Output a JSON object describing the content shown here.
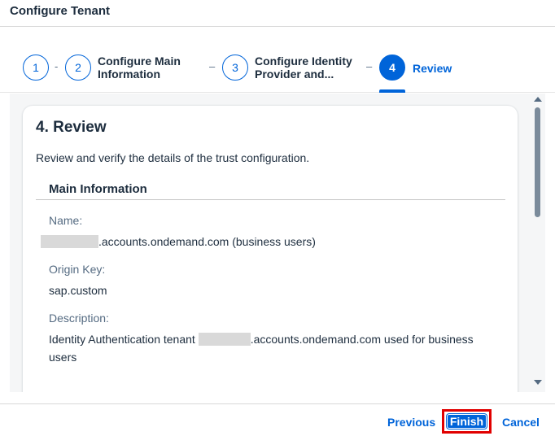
{
  "dialog": {
    "title": "Configure Tenant"
  },
  "wizard": {
    "steps": [
      {
        "number": "1",
        "label": ""
      },
      {
        "number": "2",
        "label_line1": "Configure Main",
        "label_line2": "Information"
      },
      {
        "number": "3",
        "label_line1": "Configure Identity",
        "label_line2": "Provider and..."
      },
      {
        "number": "4",
        "label": "Review"
      }
    ],
    "separator": "-",
    "separator_long": "–",
    "active_color": "#0064d9"
  },
  "review": {
    "title": "4. Review",
    "description": "Review and verify the details of the trust configuration.",
    "section_title": "Main Information",
    "fields": [
      {
        "label": "Name:",
        "value_suffix": ".accounts.ondemand.com (business users)"
      },
      {
        "label": "Origin Key:",
        "value": "sap.custom"
      },
      {
        "label": "Description:",
        "value_prefix": "Identity Authentication tenant ",
        "value_suffix": ".accounts.ondemand.com used for business",
        "value_line2": "users"
      }
    ]
  },
  "footer": {
    "previous_label": "Previous",
    "finish_label": "Finish",
    "cancel_label": "Cancel",
    "highlight_color": "#e10000"
  }
}
